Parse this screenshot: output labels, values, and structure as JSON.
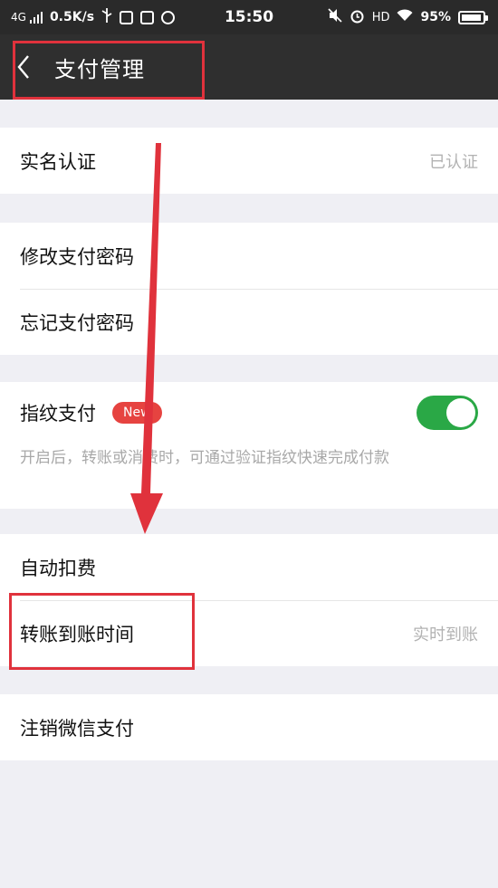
{
  "status_bar": {
    "network": "4G",
    "speed": "0.5K/s",
    "time": "15:50",
    "hd": "HD",
    "battery": "95%",
    "battery_fraction": 0.95,
    "icons": [
      "signal-icon",
      "usb-icon",
      "notification-icon",
      "screenshot-icon",
      "qq-icon",
      "mute-icon",
      "alarm-icon",
      "wifi-icon",
      "battery-icon"
    ]
  },
  "header": {
    "title": "支付管理",
    "back_icon": "chevron-left-icon"
  },
  "groups": [
    {
      "rows": [
        {
          "label": "实名认证",
          "value": "已认证"
        }
      ]
    },
    {
      "rows": [
        {
          "label": "修改支付密码"
        },
        {
          "label": "忘记支付密码"
        }
      ]
    },
    {
      "fingerprint": {
        "label": "指纹支付",
        "badge": "New",
        "enabled": true,
        "description": "开启后，转账或消费时，可通过验证指纹快速完成付款"
      }
    },
    {
      "rows": [
        {
          "label": "自动扣费"
        },
        {
          "label": "转账到账时间",
          "value": "实时到账"
        }
      ]
    },
    {
      "rows": [
        {
          "label": "注销微信支付"
        }
      ]
    }
  ],
  "colors": {
    "status_bar": "#2a2a2a",
    "title_bar": "#2f2f2f",
    "page_bg": "#efeff4",
    "toggle_on": "#2aa846",
    "badge": "#e64340",
    "annotation": "#e0323c"
  }
}
